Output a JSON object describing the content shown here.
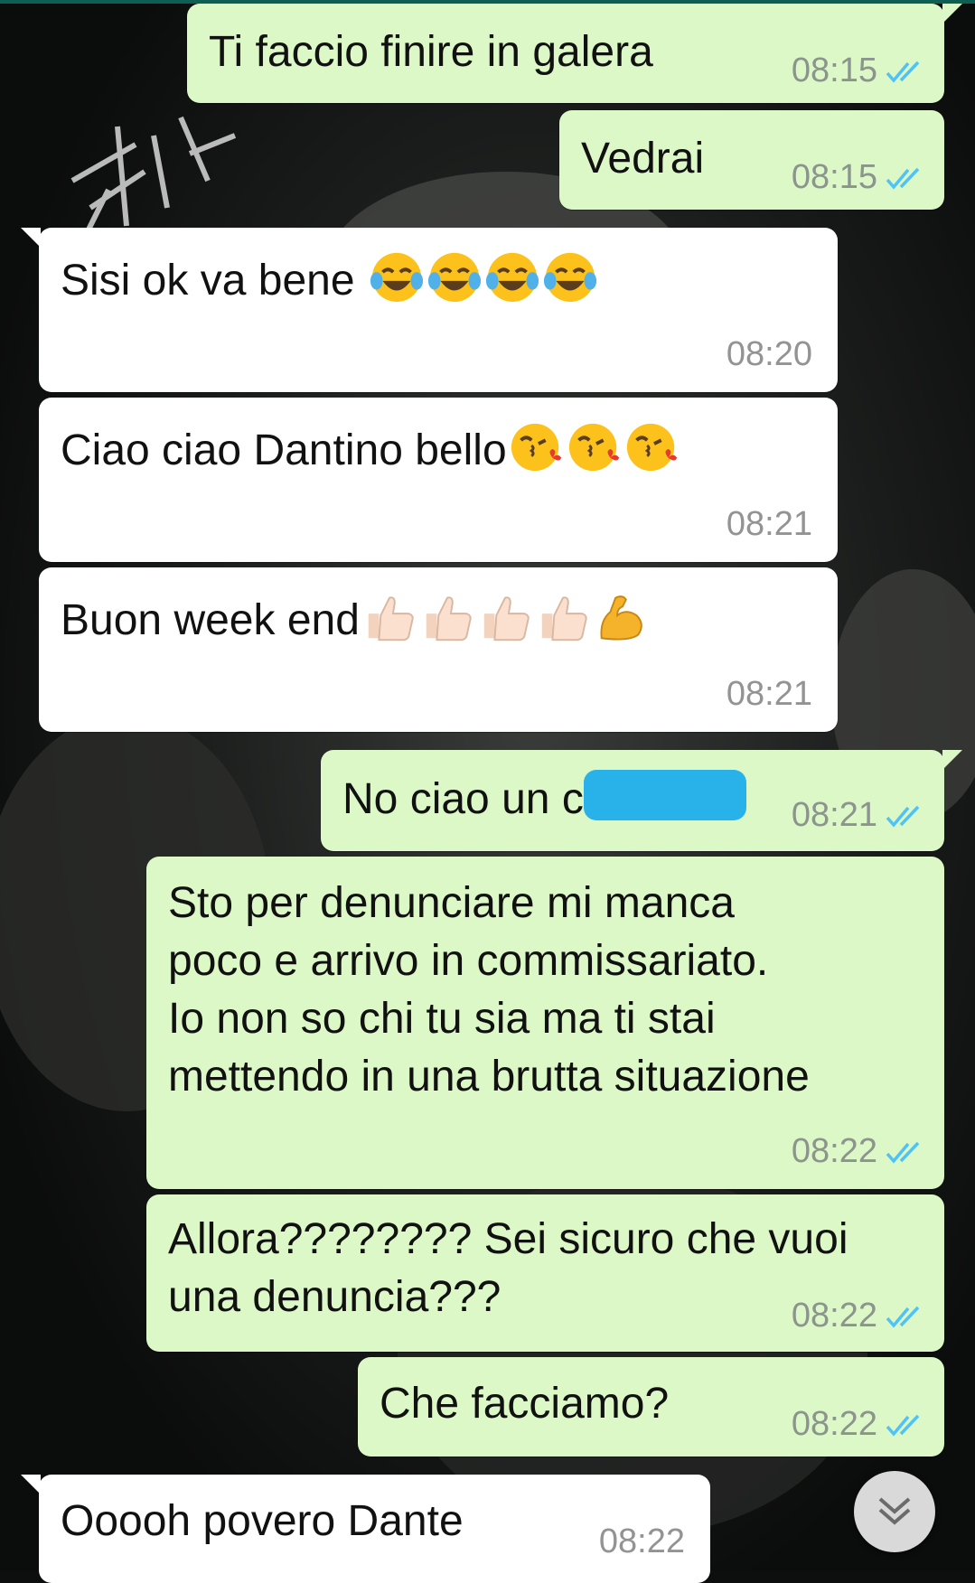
{
  "messages": [
    {
      "text": "Ti faccio finire in galera",
      "time": "08:15",
      "direction": "outgoing",
      "status": "read"
    },
    {
      "text": "Vedrai",
      "time": "08:15",
      "direction": "outgoing",
      "status": "read"
    },
    {
      "text": "Sisi ok va bene ",
      "emoji": [
        "face-with-tears-of-joy",
        "face-with-tears-of-joy",
        "face-with-tears-of-joy",
        "face-with-tears-of-joy"
      ],
      "time": "08:20",
      "direction": "incoming"
    },
    {
      "text": "Ciao ciao Dantino bello",
      "emoji": [
        "face-blowing-kiss",
        "face-blowing-kiss",
        "face-blowing-kiss"
      ],
      "time": "08:21",
      "direction": "incoming"
    },
    {
      "text": "Buon week end",
      "emoji": [
        "thumbs-up-light",
        "thumbs-up-light",
        "thumbs-up-light",
        "thumbs-up-light",
        "flexed-biceps"
      ],
      "time": "08:21",
      "direction": "incoming"
    },
    {
      "text": "No ciao un c",
      "redacted": true,
      "time": "08:21",
      "direction": "outgoing",
      "status": "read"
    },
    {
      "lines": [
        "Sto per denunciare mi manca",
        "poco e arrivo in commissariato.",
        "Io non so chi tu sia ma ti stai",
        "mettendo in una brutta situazione"
      ],
      "time": "08:22",
      "direction": "outgoing",
      "status": "read"
    },
    {
      "lines": [
        "Allora???????? Sei sicuro che vuoi",
        "una denuncia???"
      ],
      "time": "08:22",
      "direction": "outgoing",
      "status": "read"
    },
    {
      "text": "Che facciamo?",
      "time": "08:22",
      "direction": "outgoing",
      "status": "read"
    },
    {
      "text": "Ooooh povero Dante",
      "time": "08:22",
      "direction": "incoming"
    }
  ],
  "colors": {
    "outgoing_bubble": "#dcf8c6",
    "incoming_bubble": "#ffffff",
    "read_ticks": "#4fc3f7",
    "timestamp": "#8b948d",
    "redaction": "#29b2ea"
  },
  "scroll_button_icon": "double-chevron-down-icon"
}
